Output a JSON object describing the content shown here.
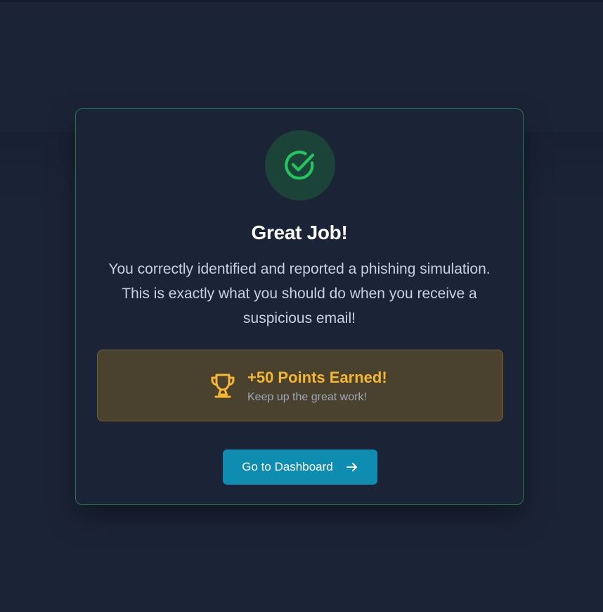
{
  "modal": {
    "icon": "check-circle-icon",
    "title": "Great Job!",
    "message": "You correctly identified and reported a phishing simulation. This is exactly what you should do when you receive a suspicious email!",
    "reward": {
      "icon": "trophy-icon",
      "title": "+50 Points Earned!",
      "subtitle": "Keep up the great work!"
    },
    "button": {
      "label": "Go to Dashboard",
      "icon": "arrow-right-icon"
    }
  },
  "colors": {
    "background": "#1b2436",
    "success": "#22c55e",
    "success_bg": "#1c4338",
    "reward_accent": "#f5b82e",
    "reward_bg": "#4a412f",
    "button": "#0e8cb1"
  }
}
